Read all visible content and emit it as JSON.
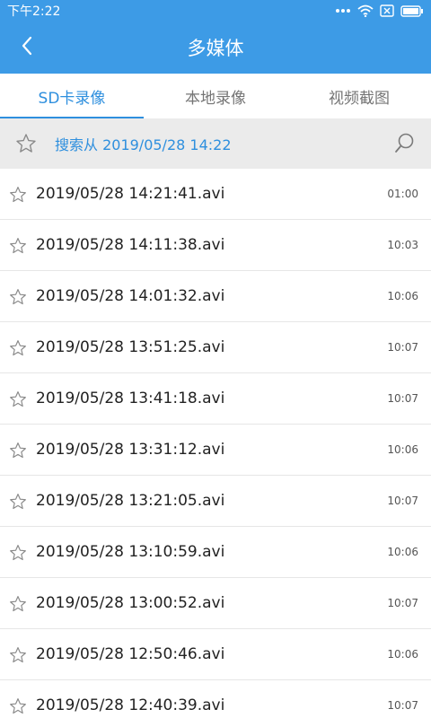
{
  "status_bar": {
    "time": "下午2:22",
    "icons": [
      "more-dots-icon",
      "wifi-icon",
      "sim-none-icon",
      "battery-icon"
    ]
  },
  "app_bar": {
    "back_icon": "chevron-left-icon",
    "title": "多媒体"
  },
  "tabs": [
    {
      "label": "SD卡录像",
      "active": true
    },
    {
      "label": "本地录像",
      "active": false
    },
    {
      "label": "视频截图",
      "active": false
    }
  ],
  "search": {
    "text": "搜索从 2019/05/28 14:22",
    "star_icon": "star-outline-icon",
    "search_icon": "search-icon"
  },
  "recordings": [
    {
      "name": "2019/05/28 14:21:41.avi",
      "duration": "01:00"
    },
    {
      "name": "2019/05/28 14:11:38.avi",
      "duration": "10:03"
    },
    {
      "name": "2019/05/28 14:01:32.avi",
      "duration": "10:06"
    },
    {
      "name": "2019/05/28 13:51:25.avi",
      "duration": "10:07"
    },
    {
      "name": "2019/05/28 13:41:18.avi",
      "duration": "10:07"
    },
    {
      "name": "2019/05/28 13:31:12.avi",
      "duration": "10:06"
    },
    {
      "name": "2019/05/28 13:21:05.avi",
      "duration": "10:07"
    },
    {
      "name": "2019/05/28 13:10:59.avi",
      "duration": "10:06"
    },
    {
      "name": "2019/05/28 13:00:52.avi",
      "duration": "10:07"
    },
    {
      "name": "2019/05/28 12:50:46.avi",
      "duration": "10:06"
    },
    {
      "name": "2019/05/28 12:40:39.avi",
      "duration": "10:07"
    }
  ],
  "colors": {
    "header": "#3d9be6",
    "accent": "#2e8fde",
    "search_bg": "#ebebeb"
  }
}
